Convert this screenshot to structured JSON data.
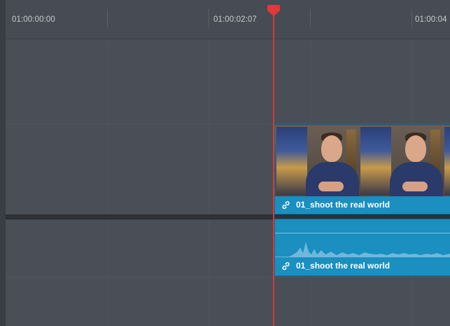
{
  "ruler": {
    "timecodes": [
      "01:00:00:00",
      "01:00:02:07",
      "01:00:04"
    ]
  },
  "video_clip": {
    "name": "01_shoot the real world",
    "link_icon": "link-icon",
    "color": "#1a8fc0"
  },
  "audio_clip": {
    "name": "01_shoot the real world",
    "link_icon": "link-icon",
    "color": "#1a8fc0"
  },
  "playhead": {
    "timecode": "01:00:02:07",
    "color": "#d8383a"
  }
}
